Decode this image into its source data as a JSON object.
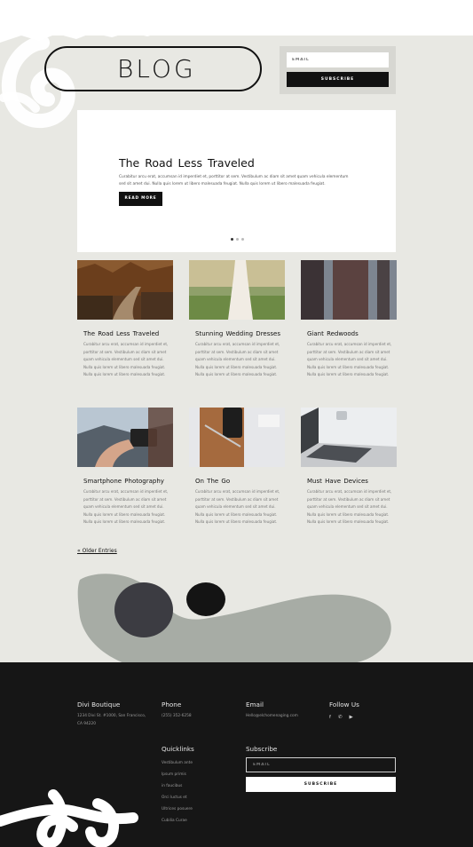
{
  "header": {
    "title": "BLOG",
    "email_placeholder": "EMAIL",
    "subscribe_label": "SUBSCRIBE"
  },
  "hero": {
    "title": "The Road Less Traveled",
    "text": "Curabitur arcu erat, accumsan id imperdiet et, porttitor at sem. Vestibulum ac diam sit amet quam vehicula elementum sed sit amet dui. Nulla quis lorem ut libero malesuada feugiat. Nulla quis lorem ut libero malesuada feugiat.",
    "button": "READ MORE",
    "slides": 3,
    "active_slide": 1
  },
  "posts": [
    {
      "title": "The Road Less Traveled",
      "image": "forest-road-photo",
      "text": "Curabitur arcu erat, accumsan id imperdiet et, porttitor at sem. Vestibulum ac diam sit amet quam vehicula elementum sed sit amet dui. Nulla quis lorem ut libero malesuada feugiat. Nulla quis lorem ut libero malesuada feugiat."
    },
    {
      "title": "Stunning Wedding Dresses",
      "image": "wedding-dress-photo",
      "text": "Curabitur arcu erat, accumsan id imperdiet et, porttitor at sem. Vestibulum ac diam sit amet quam vehicula elementum sed sit amet dui. Nulla quis lorem ut libero malesuada feugiat. Nulla quis lorem ut libero malesuada feugiat."
    },
    {
      "title": "Giant Redwoods",
      "image": "redwood-trees-photo",
      "text": "Curabitur arcu erat, accumsan id imperdiet et, porttitor at sem. Vestibulum ac diam sit amet quam vehicula elementum sed sit amet dui. Nulla quis lorem ut libero malesuada feugiat. Nulla quis lorem ut libero malesuada feugiat."
    },
    {
      "title": "Smartphone Photography",
      "image": "smartphone-camera-photo",
      "text": "Curabitur arcu erat, accumsan id imperdiet et, porttitor at sem. Vestibulum ac diam sit amet quam vehicula elementum sed sit amet dui. Nulla quis lorem ut libero malesuada feugiat. Nulla quis lorem ut libero malesuada feugiat."
    },
    {
      "title": "On The Go",
      "image": "phone-on-notebook-photo",
      "text": "Curabitur arcu erat, accumsan id imperdiet et, porttitor at sem. Vestibulum ac diam sit amet quam vehicula elementum sed sit amet dui. Nulla quis lorem ut libero malesuada feugiat. Nulla quis lorem ut libero malesuada feugiat."
    },
    {
      "title": "Must Have Devices",
      "image": "laptop-keyboard-photo",
      "text": "Curabitur arcu erat, accumsan id imperdiet et, porttitor at sem. Vestibulum ac diam sit amet quam vehicula elementum sed sit amet dui. Nulla quis lorem ut libero malesuada feugiat. Nulla quis lorem ut libero malesuada feugiat."
    }
  ],
  "older_entries": "« Older Entries",
  "footer": {
    "brand": "Divi Boutique",
    "address": "1234 Divi St. #1000, San Francisco, CA 94220",
    "phone_heading": "Phone",
    "phone": "(255) 352-6258",
    "email_heading": "Email",
    "email": "Hello@elchomenaging.com",
    "follow_heading": "Follow Us",
    "social_icons": [
      "facebook-icon",
      "twitter-icon",
      "youtube-icon"
    ],
    "quicklinks_heading": "Quicklinks",
    "quicklinks": [
      "Vestibulum ante",
      "Ipsum primis",
      "in faucibus",
      "Orci luctus et",
      "Ultrices posuere",
      "Cubilia Curae"
    ],
    "subscribe_heading": "Subscribe",
    "email_placeholder": "EMAIL",
    "subscribe_label": "SUBSCRIBE"
  },
  "colors": {
    "background": "#e8e8e3",
    "footer": "#161616",
    "accent": "#111111",
    "brush_gray": "#a7aca5",
    "brush_dark": "#3c3c42"
  }
}
